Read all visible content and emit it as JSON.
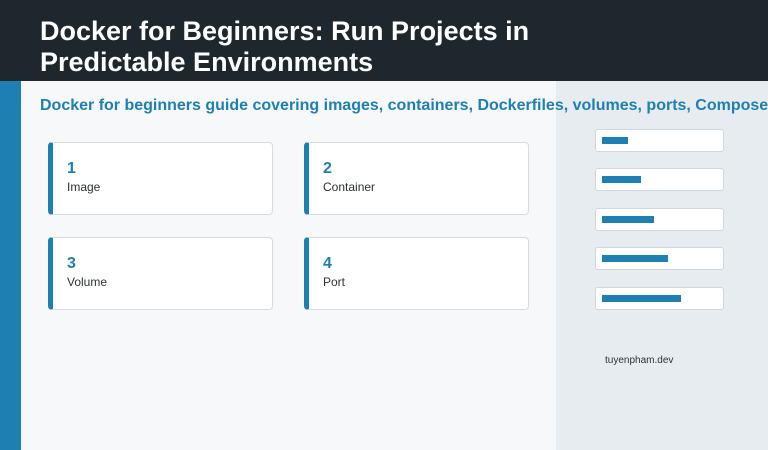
{
  "header": {
    "title": "Docker for Beginners: Run Projects in Predictable Environments"
  },
  "subtitle": "Docker for beginners guide covering images, containers, Dockerfiles, volumes, ports, Compose",
  "cards": [
    {
      "number": "1",
      "label": "Image"
    },
    {
      "number": "2",
      "label": "Container"
    },
    {
      "number": "3",
      "label": "Volume"
    },
    {
      "number": "4",
      "label": "Port"
    }
  ],
  "progress_bars": [
    {
      "fraction": 0.22
    },
    {
      "fraction": 0.34
    },
    {
      "fraction": 0.45
    },
    {
      "fraction": 0.57
    },
    {
      "fraction": 0.68
    }
  ],
  "footer": {
    "site": "tuyenpham.dev"
  },
  "colors": {
    "accent": "#1e7fb2",
    "header_bg": "#1e272e",
    "panel_bg": "#e7ecf0"
  }
}
